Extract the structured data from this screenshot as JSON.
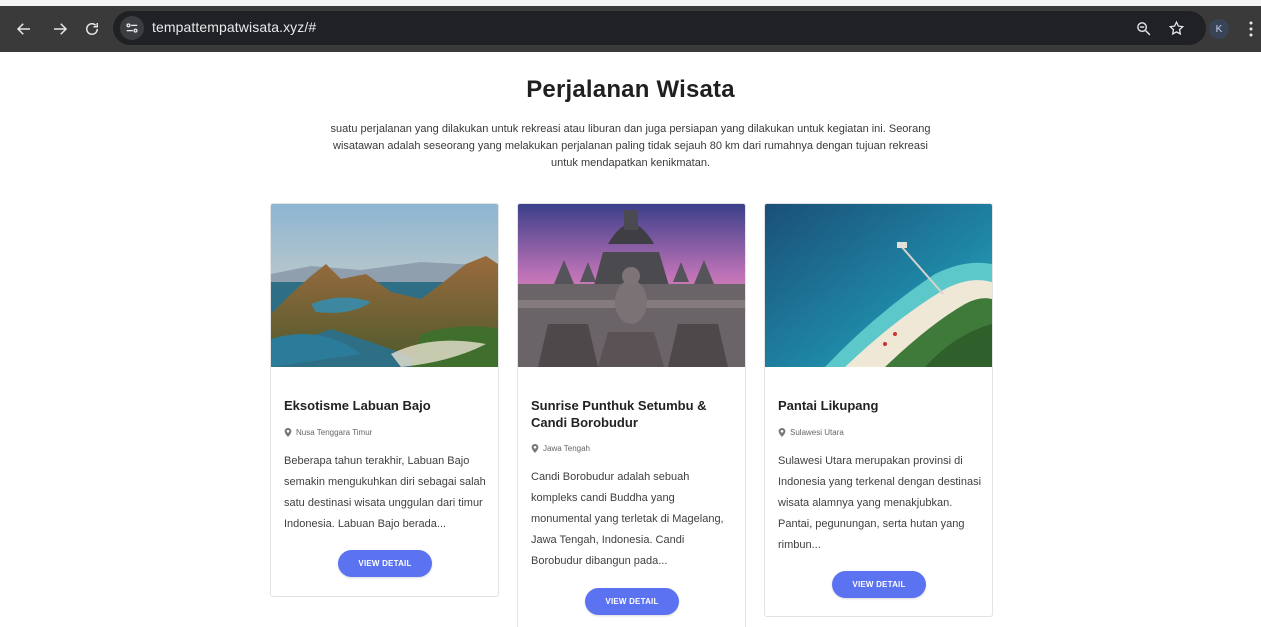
{
  "browser": {
    "url": "tempattempatwisata.xyz/#",
    "profile_initial": "K",
    "icons": [
      "back-arrow-icon",
      "forward-arrow-icon",
      "reload-icon",
      "site-info-icon",
      "zoom-icon",
      "bookmark-star-icon",
      "more-vert-icon"
    ]
  },
  "page": {
    "title": "Perjalanan Wisata",
    "description": "suatu perjalanan yang dilakukan untuk rekreasi atau liburan dan juga persiapan yang dilakukan untuk kegiatan ini. Seorang wisatawan adalah seseorang yang melakukan perjalanan paling tidak sejauh 80 km dari rumahnya dengan tujuan rekreasi untuk mendapatkan kenikmatan."
  },
  "cards": [
    {
      "title": "Eksotisme Labuan Bajo",
      "location": "Nusa Tenggara Timur",
      "text": "Beberapa tahun terakhir, Labuan Bajo semakin mengukuhkan diri sebagai salah satu destinasi wisata unggulan dari timur Indonesia. Labuan Bajo berada...",
      "button": "VIEW DETAIL"
    },
    {
      "title": "Sunrise Punthuk Setumbu & Candi Borobudur",
      "location": "Jawa Tengah",
      "text": "Candi Borobudur adalah sebuah kompleks candi Buddha yang monumental yang terletak di Magelang, Jawa Tengah, Indonesia. Candi Borobudur dibangun pada...",
      "button": "VIEW DETAIL"
    },
    {
      "title": "Pantai Likupang",
      "location": "Sulawesi Utara",
      "text": "Sulawesi Utara merupakan provinsi di Indonesia yang terkenal dengan destinasi wisata alamnya yang menakjubkan. Pantai, pegunungan, serta hutan yang rimbun...",
      "button": "VIEW DETAIL"
    }
  ],
  "colors": {
    "button": "#5b73f0",
    "toolbar": "#3a3a3a",
    "omnibox": "#202124"
  }
}
